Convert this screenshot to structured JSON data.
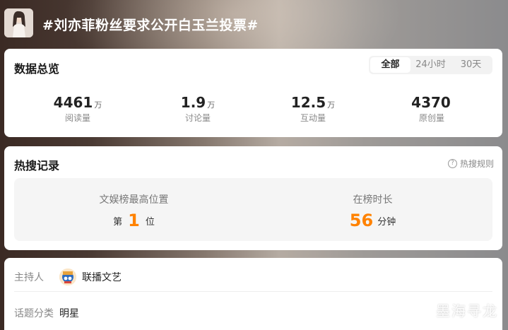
{
  "header": {
    "title": "#刘亦菲粉丝要求公开白玉兰投票#"
  },
  "overview": {
    "title": "数据总览",
    "tabs": [
      {
        "label": "全部",
        "active": true
      },
      {
        "label": "24小时",
        "active": false
      },
      {
        "label": "30天",
        "active": false
      }
    ],
    "stats": [
      {
        "value": "4461",
        "unit": "万",
        "label": "阅读量"
      },
      {
        "value": "1.9",
        "unit": "万",
        "label": "讨论量"
      },
      {
        "value": "12.5",
        "unit": "万",
        "label": "互动量"
      },
      {
        "value": "4370",
        "unit": "",
        "label": "原创量"
      }
    ]
  },
  "hot_search": {
    "title": "热搜记录",
    "rules_label": "热搜规则",
    "rules_icon": "question-circle-icon",
    "best_rank_label": "文娱榜最高位置",
    "best_rank_prefix": "第",
    "best_rank_value": "1",
    "best_rank_suffix": "位",
    "duration_label": "在榜时长",
    "duration_value": "56",
    "duration_unit": "分钟",
    "highlight_color": "#ff8200"
  },
  "info": {
    "host_label": "主持人",
    "host_name": "联播文艺",
    "category_label": "话题分类",
    "category_value": "明星"
  },
  "watermark": "墨海寻龙"
}
